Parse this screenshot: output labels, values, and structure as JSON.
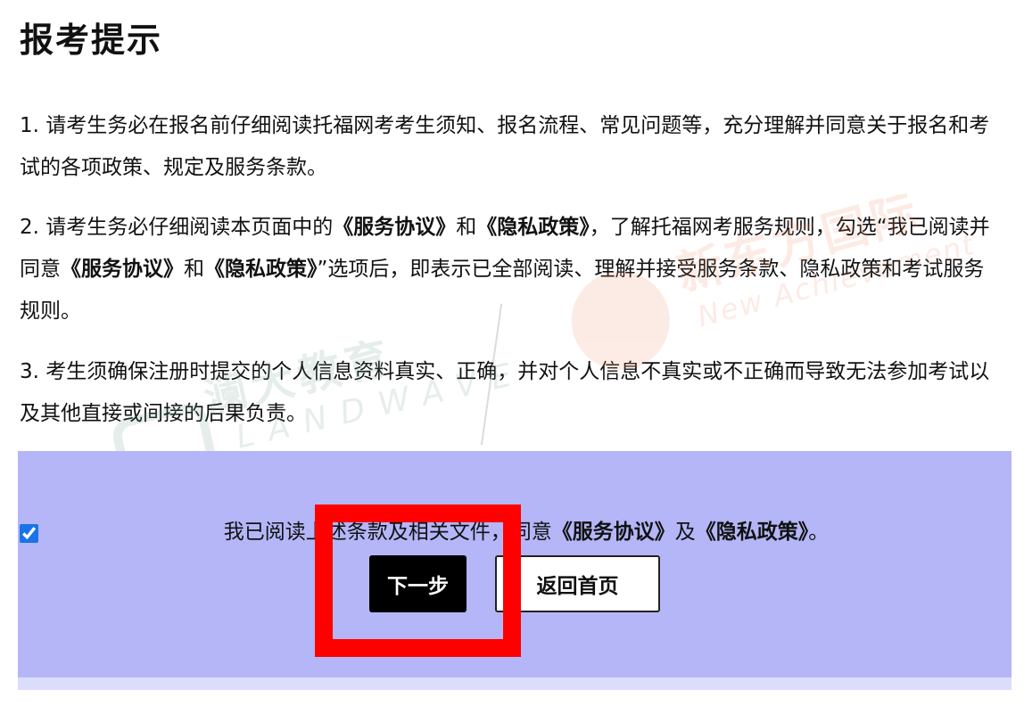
{
  "page": {
    "title": "报考提示"
  },
  "notices": {
    "p1": "1. 请考生务必在报名前仔细阅读托福网考考生须知、报名流程、常见问题等，充分理解并同意关于报名和考试的各项政策、规定及服务条款。",
    "p2_before": "2. 请考生务必仔细阅读本页面中的",
    "p2_service": "《服务协议》",
    "p2_and1": "和",
    "p2_privacy": "《隐私政策》",
    "p2_middle": "，了解托福网考服务规则，勾选“我已阅读并同意",
    "p2_service2": "《服务协议》",
    "p2_and2": "和",
    "p2_privacy2": "《隐私政策》",
    "p2_after": "”选项后，即表示已全部阅读、理解并接受服务条款、隐私政策和考试服务规则。",
    "p3": "3. 考生须确保注册时提交的个人信息资料真实、正确，并对个人信息不真实或不正确而导致无法参加考试以及其他直接或间接的后果负责。"
  },
  "agreement": {
    "checked": true,
    "text_before": "我已阅读上述条款及相关文件，同意",
    "service_link": "《服务协议》",
    "and": "及",
    "privacy_link": "《隐私政策》",
    "text_after": "。"
  },
  "buttons": {
    "next_label": "下一步",
    "home_label": "返回首页"
  },
  "watermarks": {
    "left_cn": "澜大教育",
    "left_en": "LANDWAVE",
    "right_cn": "新东方国际",
    "right_en": "New Achievement"
  },
  "colors": {
    "panel_bg": "#b4b6f7",
    "next_bg": "#000000",
    "highlight": "#ff0000",
    "checkbox": "#1a73e8"
  }
}
